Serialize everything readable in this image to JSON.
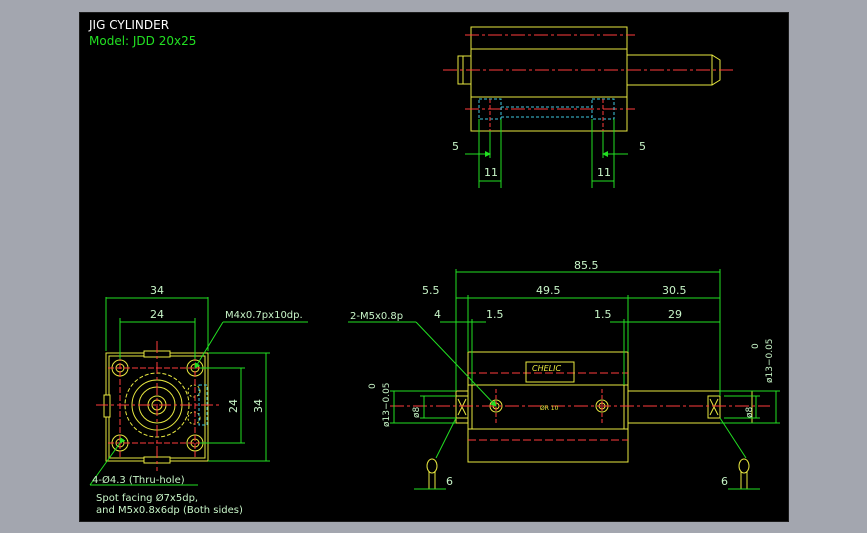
{
  "title": {
    "line1": "JIG CYLINDER",
    "line2": "Model:  JDD  20x25"
  },
  "colors": {
    "background": "#a3a6af",
    "sheet": "#000000",
    "outline": "#e8e840",
    "center_line": "#ff3b3b",
    "dimension": "#22e022",
    "hidden": "#40c8e0",
    "text": "#c8f5c8"
  },
  "top_view": {
    "left_dims": [
      "5",
      "11"
    ],
    "right_dims": [
      "5",
      "11"
    ]
  },
  "left_view": {
    "width_outer": "34",
    "width_inner": "24",
    "height_inner": "24",
    "height_outer": "34",
    "thread_note": "M4x0.7px10dp.",
    "hole_note": "4-Ø4.3 (Thru-hole)",
    "spot_note_1": "Spot facing Ø7x5dp,",
    "spot_note_2": "and M5x0.8x6dp (Both sides)"
  },
  "front_view": {
    "total_length": "85.5",
    "d_5_5": "5.5",
    "d_49_5": "49.5",
    "d_30_5": "30.5",
    "d_4": "4",
    "d_1_5_left": "1.5",
    "d_1_5_right": "1.5",
    "d_29": "29",
    "port_note": "2-M5x0.8p",
    "tol_left_upper": "0",
    "tol_left_lower": "ø13−0.05",
    "tol_right_upper": "0",
    "tol_right_lower": "ø13−0.05",
    "dia_left": "ø8",
    "dia_right": "ø8",
    "end_left": "6",
    "end_right": "6",
    "plate_brand": "CHELIC",
    "plate_port": "ØR 10"
  }
}
